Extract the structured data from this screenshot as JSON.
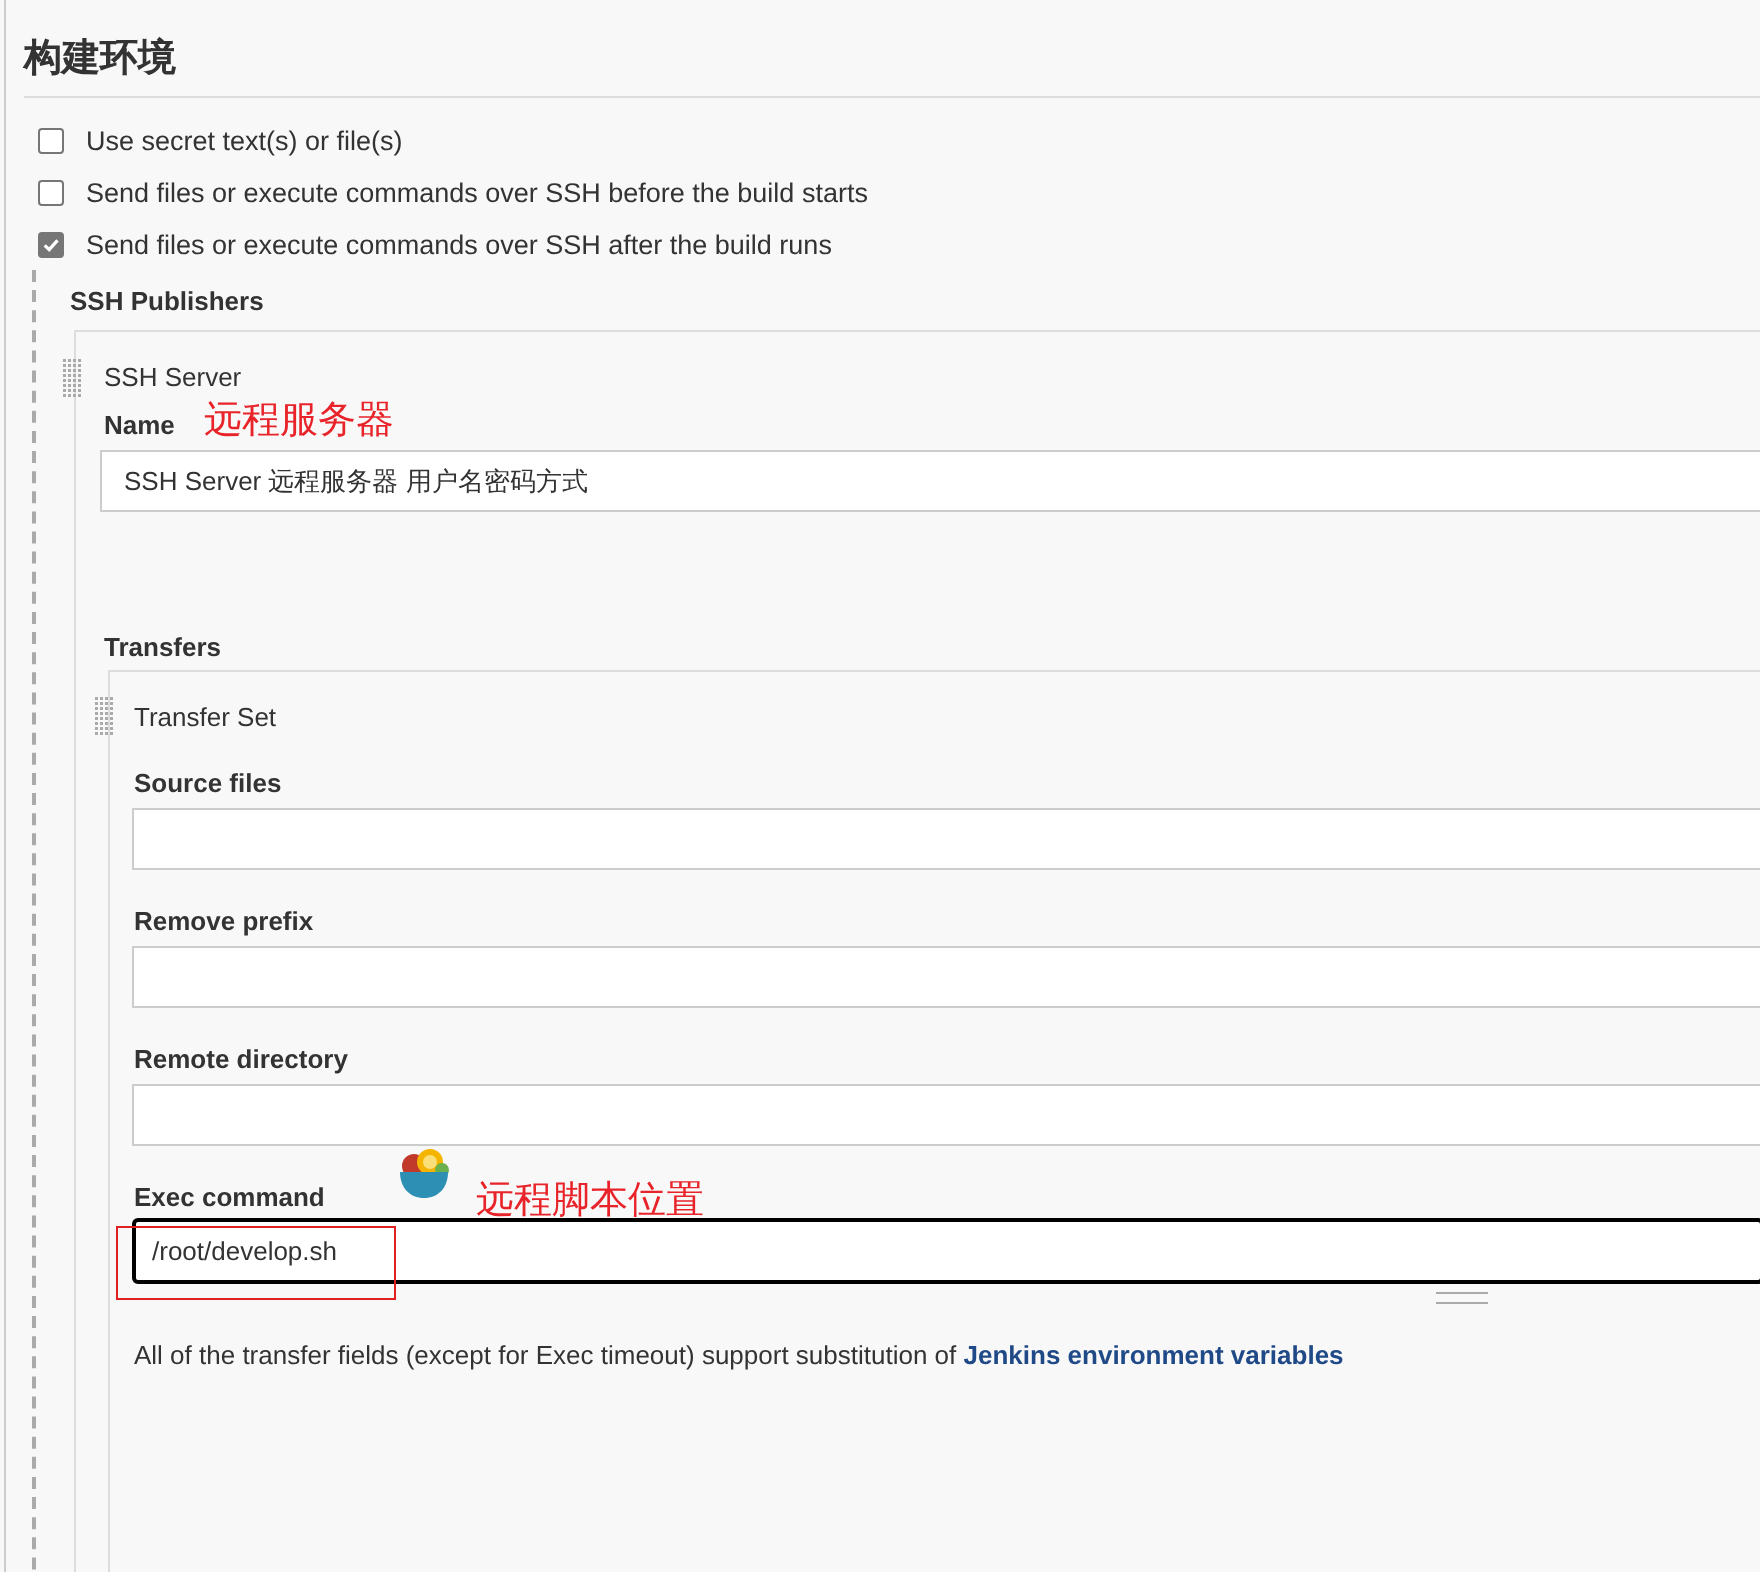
{
  "section": {
    "title": "构建环境"
  },
  "options": [
    {
      "label": "Use secret text(s) or file(s)",
      "checked": false
    },
    {
      "label": "Send files or execute commands over SSH before the build starts",
      "checked": false
    },
    {
      "label": "Send files or execute commands over SSH after the build runs",
      "checked": true
    }
  ],
  "ssh_publishers": {
    "title": "SSH Publishers",
    "server": {
      "title": "SSH Server",
      "name_label": "Name",
      "name_annotation": "远程服务器",
      "name_value": "SSH Server 远程服务器 用户名密码方式",
      "transfers_title": "Transfers",
      "transfer_set": {
        "title": "Transfer Set",
        "fields": [
          {
            "label": "Source files",
            "kind": "input"
          },
          {
            "label": "Remove prefix",
            "kind": "input"
          },
          {
            "label": "Remote directory",
            "kind": "input"
          },
          {
            "label": "Exec command",
            "kind": "textarea",
            "value": "/root/develop.sh",
            "focused": true,
            "annotation": "远程脚本位置"
          }
        ],
        "note": {
          "text": "All of the transfer fields (except for Exec timeout) support substitution of",
          "link": "Jenkins environment variables"
        }
      }
    }
  }
}
